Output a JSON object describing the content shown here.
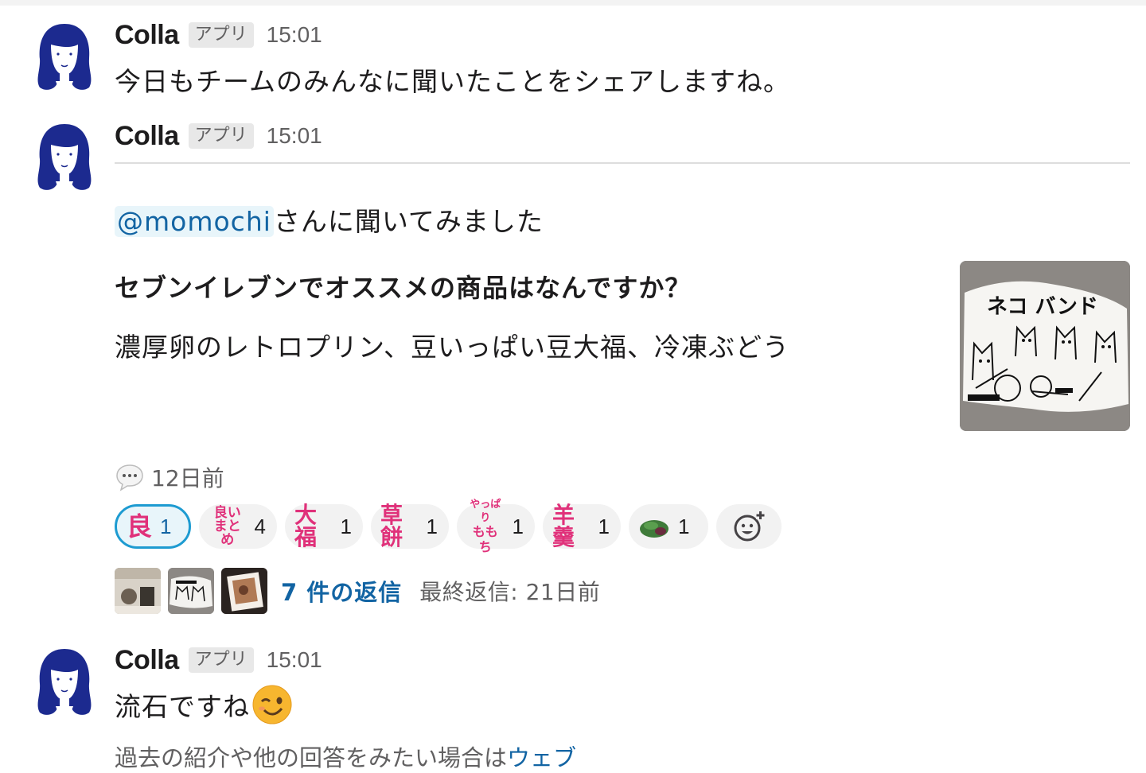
{
  "messages": [
    {
      "author": "Colla",
      "badge": "アプリ",
      "time": "15:01",
      "text": "今日もチームのみんなに聞いたことをシェアしますね。"
    },
    {
      "author": "Colla",
      "badge": "アプリ",
      "time": "15:01",
      "mention": "@momochi",
      "intro": "さんに聞いてみました",
      "question": "セブンイレブンでオススメの商品はなんですか？",
      "answer": "濃厚卵のレトロプリン、豆いっぱい豆大福、冷凍ぶどう",
      "thumbnail_caption": "ネコ バンド",
      "meta_time": "12日前",
      "reactions": [
        {
          "emoji": "良",
          "count": "1",
          "active": true
        },
        {
          "emoji": "良いまとめ",
          "lines": [
            "良い",
            "まとめ"
          ],
          "count": "4"
        },
        {
          "emoji": "大福",
          "count": "1"
        },
        {
          "emoji": "草餅",
          "count": "1"
        },
        {
          "emoji": "やっぱりももち",
          "lines": [
            "やっぱり",
            "ももち"
          ],
          "count": "1"
        },
        {
          "emoji": "羊羹",
          "count": "1"
        },
        {
          "emoji": "green-mochi",
          "count": "1"
        }
      ],
      "add_reaction_icon": "add-reaction-icon",
      "thread": {
        "reply_label": "7 件の返信",
        "last_reply": "最終返信: 21日前"
      }
    },
    {
      "author": "Colla",
      "badge": "アプリ",
      "time": "15:01",
      "text": "流石ですね",
      "emoji": "winking-face"
    }
  ],
  "cutoff_text": {
    "prefix": "過去の紹介や他の回答をみたい場合は",
    "link": "ウェブ"
  },
  "colors": {
    "link": "#1264a3",
    "reaction_pink": "#e0317a",
    "active_border": "#1d9bd1",
    "avatar_navy": "#1c2a8f"
  }
}
